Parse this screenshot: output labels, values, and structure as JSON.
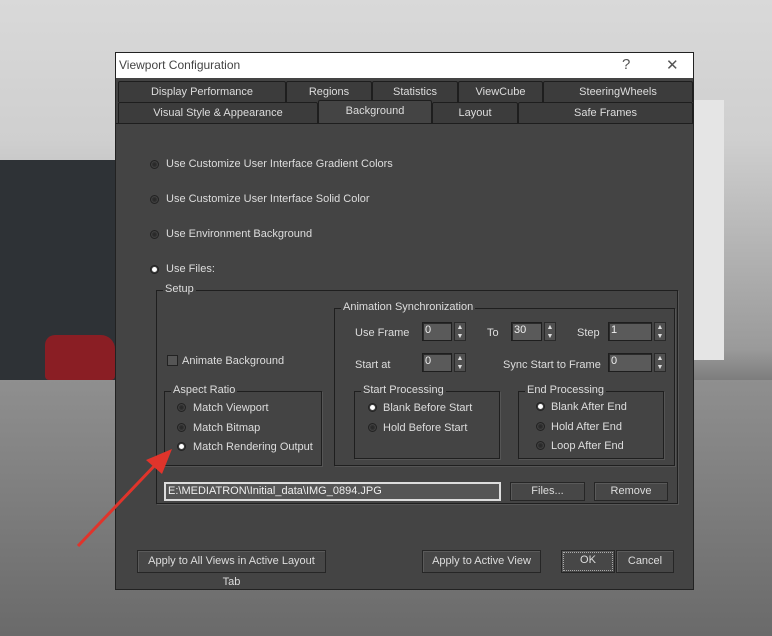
{
  "window": {
    "title": "Viewport Configuration",
    "help": "?",
    "close": "✕"
  },
  "tabs_row1": [
    "Display Performance",
    "Regions",
    "Statistics",
    "ViewCube",
    "SteeringWheels"
  ],
  "tabs_row2": [
    "Visual Style & Appearance",
    "Background",
    "Layout",
    "Safe Frames"
  ],
  "active_tab": "Background",
  "source": {
    "options": [
      "Use Customize User Interface Gradient Colors",
      "Use Customize User Interface Solid Color",
      "Use Environment Background",
      "Use Files:"
    ],
    "selected": 3
  },
  "setup": {
    "label": "Setup",
    "animate_background": "Animate Background",
    "animate_checked": false,
    "aspect_ratio": {
      "label": "Aspect Ratio",
      "options": [
        "Match Viewport",
        "Match Bitmap",
        "Match Rendering Output"
      ],
      "selected": 2
    },
    "anim_sync": {
      "label": "Animation Synchronization",
      "use_frame_label": "Use Frame",
      "use_frame": "0",
      "to_label": "To",
      "to": "30",
      "step_label": "Step",
      "step": "1",
      "start_at_label": "Start at",
      "start_at": "0",
      "sync_label": "Sync Start to Frame",
      "sync": "0",
      "start_processing": {
        "label": "Start Processing",
        "options": [
          "Blank Before Start",
          "Hold Before Start"
        ],
        "selected": 0
      },
      "end_processing": {
        "label": "End Processing",
        "options": [
          "Blank After End",
          "Hold After End",
          "Loop After End"
        ],
        "selected": 0
      }
    },
    "file_path": "E:\\MEDIATRON\\Initial_data\\IMG_0894.JPG",
    "files_button": "Files...",
    "remove_button": "Remove"
  },
  "footer": {
    "apply_all": "Apply to All Views in Active Layout Tab",
    "apply_active": "Apply to Active View",
    "ok": "OK",
    "cancel": "Cancel"
  },
  "annotation_color": "#e0342b"
}
